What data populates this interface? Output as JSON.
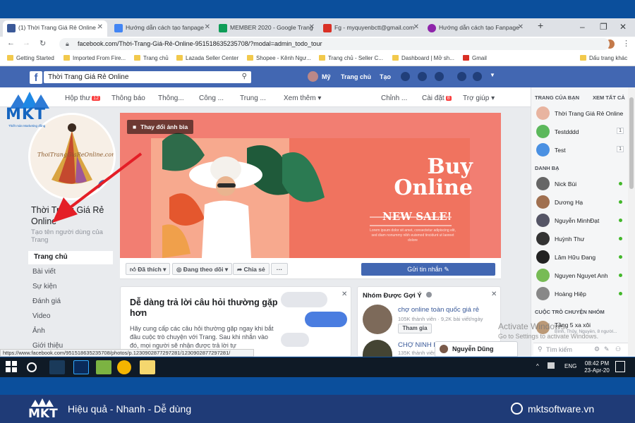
{
  "browser": {
    "tabs": [
      {
        "title": "(1) Thời Trang Giá Rẻ Online - ",
        "icon": "facebook-favicon",
        "color": "#3b5998",
        "active": true
      },
      {
        "title": "Hướng dẫn cách tạo fanpage",
        "icon": "docs-favicon",
        "color": "#4285f4",
        "active": false
      },
      {
        "title": "MEMBER 2020 - Google Trang",
        "icon": "sheets-favicon",
        "color": "#0f9d58",
        "active": false
      },
      {
        "title": "Fg - myquyenbctt@gmail.com",
        "icon": "gmail-favicon",
        "color": "#d93025",
        "active": false
      },
      {
        "title": "Hướng dẫn cách tạo Fanpage",
        "icon": "webpage-favicon",
        "color": "#8e24aa",
        "active": false
      }
    ],
    "new_tab": "+",
    "url": "facebook.com/Thời-Trang-Giá-Rẻ-Online-951518635235708/?modal=admin_todo_tour",
    "bookmarks": [
      "Getting Started",
      "Imported From Fire...",
      "Trang chủ",
      "Lazada Seller Center",
      "Shopee - Kênh Ngư...",
      "Trang chủ - Seller C...",
      "Dashboard | Mở sh...",
      "Gmail",
      "Dấu trang khác"
    ],
    "status_url": "https://www.facebook.com/951518635235708/photos/p.1230902877297281/1230902877297281/"
  },
  "fb_header": {
    "search_value": "Thời Trang Giá Rẻ Online",
    "user": "Mỹ",
    "home": "Trang chủ",
    "create": "Tạo"
  },
  "page_nav": {
    "items": [
      "Hộp thư",
      "Thông báo",
      "Thông...",
      "Công ...",
      "Trung ...",
      "Xem thêm"
    ],
    "inbox_badge": "12",
    "right_items": [
      "Chỉnh ...",
      "Cài đặt",
      "Trợ giúp"
    ],
    "settings_badge": "8"
  },
  "page": {
    "avatar_text": "ThoiTrangGiaReOnline.com",
    "title": "Thời Trang Giá Rẻ Online",
    "username_link": "Tạo tên người dùng của Trang",
    "left_nav": [
      "Trang chủ",
      "Bài viết",
      "Sự kiện",
      "Đánh giá",
      "Video",
      "Ảnh",
      "Giới thiệu"
    ]
  },
  "cover": {
    "change_button": "Thay đổi ảnh bìa",
    "headline": "Buy Online",
    "sale": "NEW SALE!",
    "small_text": "Lorem ipsum dolor sit amet, consectetur adipiscing elit, sed diam nonummy nibh euismod tincidunt ut laoreet dolore"
  },
  "actions": {
    "liked": "Đã thích",
    "following": "Đang theo dõi",
    "share": "Chia sẻ",
    "more": "···",
    "send_message": "Gửi tin nhắn"
  },
  "question_card": {
    "title": "Dễ dàng trả lời câu hỏi thường gặp hơn",
    "body": "Hãy cung cấp các câu hỏi thường gặp ngay khi bắt đầu cuộc trò chuyện với Trang. Sau khi nhắn vào đó, mọi người sẽ nhận được trả lời tự"
  },
  "suggest_card": {
    "title": "Nhóm Được Gợi Ý",
    "group1_name": "chợ online toàn quốc giá rẻ",
    "group1_meta": "105K thành viên · 9,2K bài viết/ngày",
    "join": "Tham gia",
    "group2_name": "CHỢ NINH H...",
    "group2_meta": "135K thành viên"
  },
  "chat_popup": {
    "name": "Nguyễn Dũng"
  },
  "sidebar": {
    "pages_header": "TRANG CỦA BẠN",
    "see_all": "XEM TẤT CẢ",
    "pages": [
      {
        "name": "Thời Trang Giá Rẻ Online",
        "color": "#e8b4a0"
      },
      {
        "name": "Testdddd",
        "color": "#5cb85c",
        "count": "1"
      },
      {
        "name": "Test",
        "color": "#4a90e2",
        "count": "1"
      }
    ],
    "contacts_header": "DANH BẠ",
    "contacts": [
      {
        "name": "Nick Bùi",
        "color": "#666"
      },
      {
        "name": "Dương Hạ",
        "color": "#a07050"
      },
      {
        "name": "Nguyễn MinhĐạt",
        "color": "#556"
      },
      {
        "name": "Huỳnh Thư",
        "color": "#333"
      },
      {
        "name": "Lâm Hữu Đang",
        "color": "#222"
      },
      {
        "name": "Nguyen Nguyet Anh",
        "color": "#7b5"
      },
      {
        "name": "Hoàng Hiệp",
        "color": "#888"
      }
    ],
    "groups_header": "CUỘC TRÒ CHUYỆN NHÓM",
    "group_chat": "Tầng 5 xa xôi",
    "group_chat_sub": "Bình, Thủy, Nguyễn, 8 người...",
    "search_placeholder": "Tìm kiếm"
  },
  "watermark": {
    "line1": "Activate Windows",
    "line2": "Go to Settings to activate Windows."
  },
  "taskbar": {
    "lang": "ENG",
    "time": "08:42 PM",
    "date": "23-Apr-20"
  },
  "footer": {
    "logo": "MKT",
    "tagline": "Hiệu quả - Nhanh - Dễ dùng",
    "website": "mktsoftware.vn"
  },
  "overlay_logo": {
    "text": "MKT",
    "sub": "Thiết màn Marketing đồng"
  }
}
